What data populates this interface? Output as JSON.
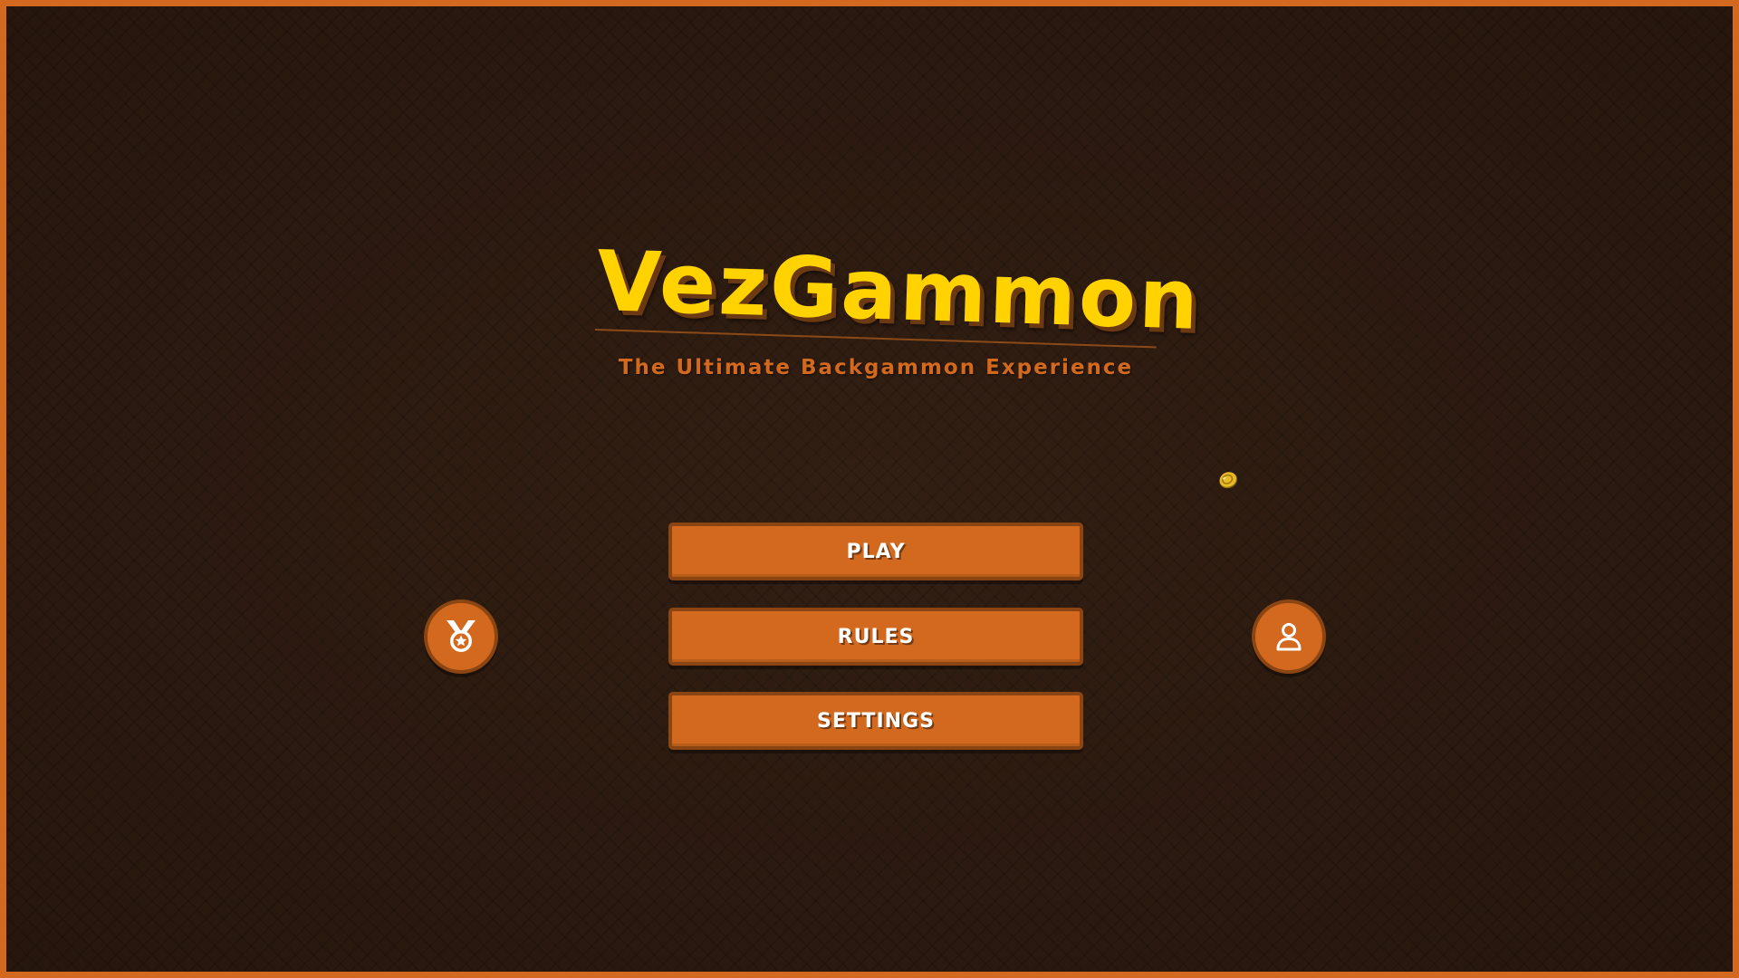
{
  "game": {
    "title": "VezGammon",
    "subtitle": "The Ultimate Backgammon Experience"
  },
  "menu": {
    "play_label": "PLAY",
    "rules_label": "RULES",
    "settings_label": "SETTINGS"
  },
  "side_buttons": {
    "left_icon": "medal-icon",
    "right_icon": "user-profile-icon"
  },
  "decorations": {
    "floating_icon": "gold-coin-icon"
  },
  "colors": {
    "accent": "#d2691e",
    "accent_border": "#8b4513",
    "title": "#ffd200",
    "background": "#2c1a10",
    "frame": "#d2691e"
  }
}
